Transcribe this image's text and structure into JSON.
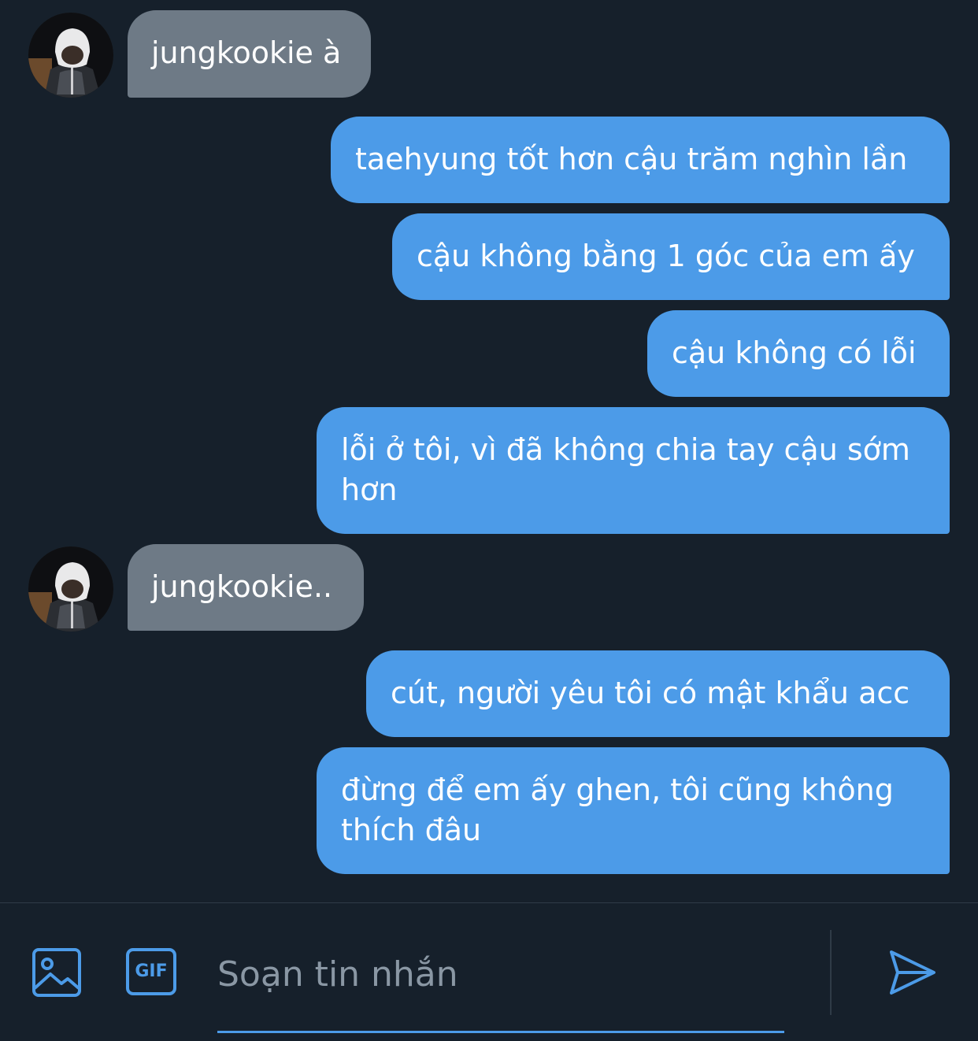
{
  "messages": [
    {
      "side": "in",
      "text": "jungkookie à"
    },
    {
      "side": "out",
      "text": "taehyung tốt hơn cậu trăm nghìn lần"
    },
    {
      "side": "out",
      "text": "cậu không bằng 1 góc của em ấy"
    },
    {
      "side": "out",
      "text": "cậu không có lỗi"
    },
    {
      "side": "out",
      "text": "lỗi ở tôi, vì đã không chia tay cậu sớm hơn"
    },
    {
      "side": "in",
      "text": "jungkookie.."
    },
    {
      "side": "out",
      "text": "cút, người yêu tôi có mật khẩu acc"
    },
    {
      "side": "out",
      "text": "đừng để em ấy ghen, tôi cũng không thích đâu"
    }
  ],
  "composer": {
    "placeholder": "Soạn tin nhắn",
    "value": "",
    "gif_label": "GIF",
    "media_icon": "image-icon",
    "gif_icon": "gif-icon",
    "send_icon": "send-icon"
  },
  "colors": {
    "background": "#16202b",
    "incoming_bubble": "#6e7a86",
    "outgoing_bubble": "#4c9be8",
    "accent": "#4c9be8"
  }
}
